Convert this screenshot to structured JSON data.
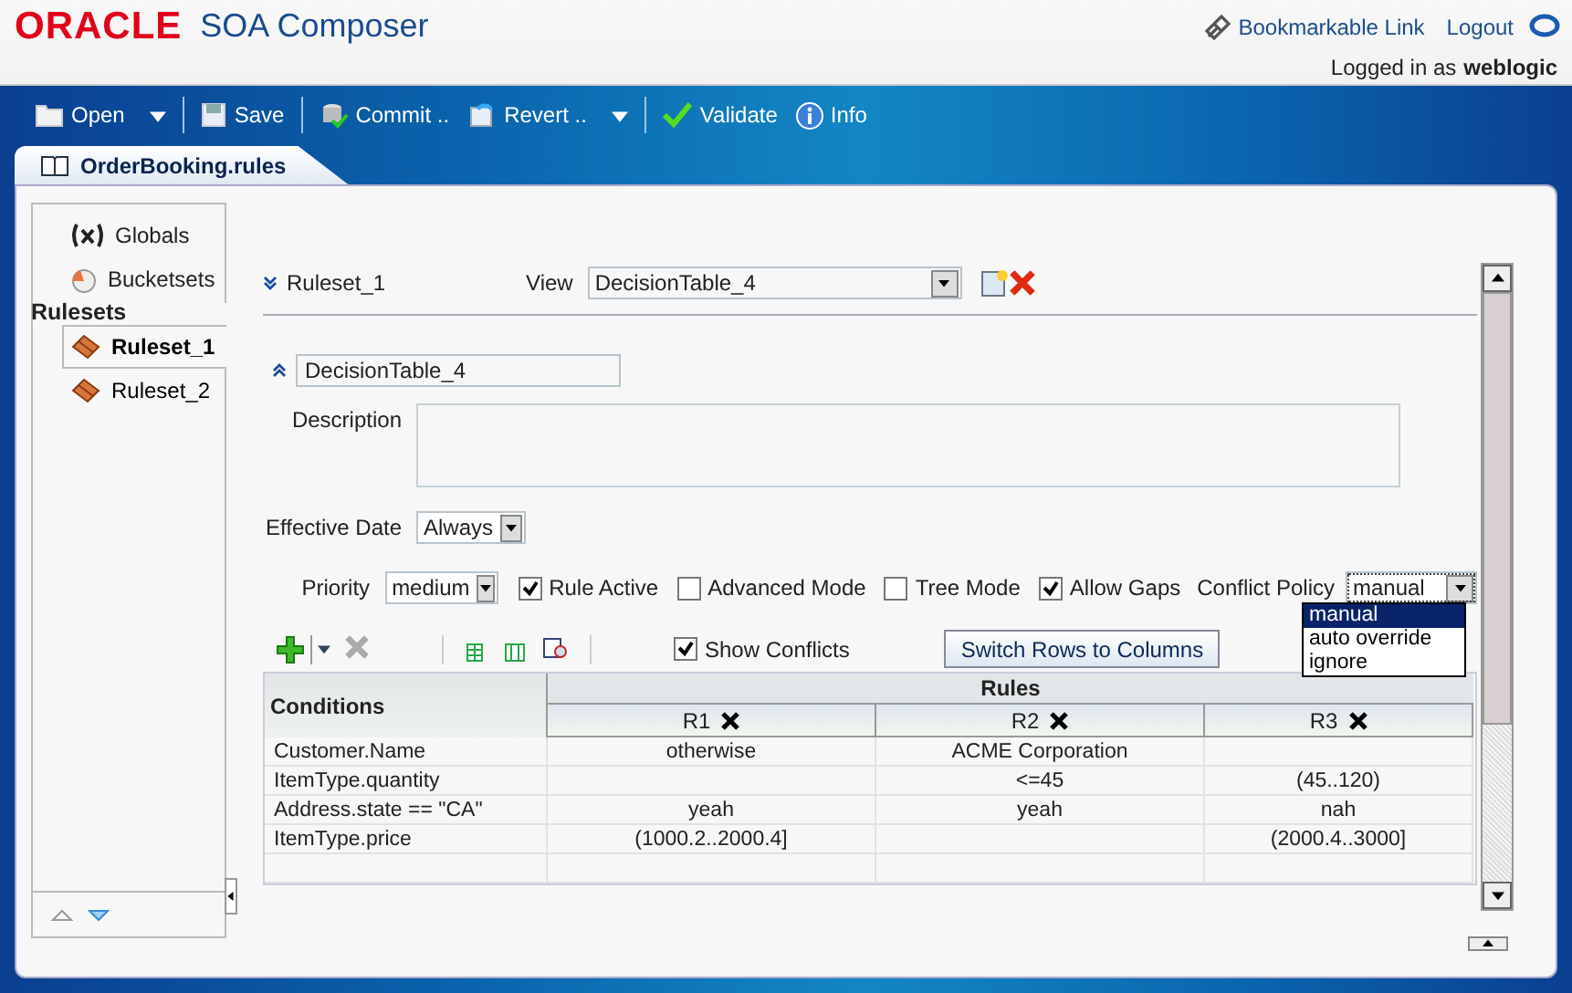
{
  "header": {
    "logo": "ORACLE",
    "product": "SOA Composer",
    "links": [
      {
        "kind": "bookmark",
        "label": "Bookmarkable Link"
      },
      {
        "kind": "logout",
        "label": "Logout"
      }
    ],
    "login_label": "Logged in as",
    "user": "weblogic"
  },
  "toolbar": [
    {
      "kind": "open",
      "label": "Open",
      "menu": true,
      "separator_after": true
    },
    {
      "kind": "save",
      "label": "Save",
      "menu": false,
      "separator_after": true
    },
    {
      "kind": "commit",
      "label": "Commit ..",
      "menu": false,
      "separator_after": false
    },
    {
      "kind": "revert",
      "label": "Revert ..",
      "menu": true,
      "separator_after": true
    },
    {
      "kind": "validate",
      "label": "Validate",
      "menu": false,
      "separator_after": false
    },
    {
      "kind": "info",
      "label": "Info",
      "menu": false,
      "separator_after": false
    }
  ],
  "document_tab": {
    "label": "OrderBooking.rules",
    "selected": true
  },
  "sidebar": {
    "items": [
      {
        "kind": "globals",
        "label": "Globals"
      },
      {
        "kind": "bucketsets",
        "label": "Bucketsets"
      }
    ],
    "section": "Rulesets",
    "rulesets": [
      {
        "label": "Ruleset_1",
        "selected": true
      },
      {
        "label": "Ruleset_2",
        "selected": false
      }
    ]
  },
  "ruleset": {
    "name": "Ruleset_1",
    "expanded": false,
    "view_label": "View",
    "view_value": "DecisionTable_4"
  },
  "decision_table": {
    "name": "DecisionTable_4",
    "expanded": true,
    "description_label": "Description",
    "effective_date_label": "Effective Date",
    "effective_date": "Always",
    "priority_label": "Priority",
    "priority": "medium",
    "options": [
      {
        "label": "Rule Active",
        "checked": true
      },
      {
        "label": "Advanced Mode",
        "checked": false
      },
      {
        "label": "Tree Mode",
        "checked": false
      },
      {
        "label": "Allow Gaps",
        "checked": true
      }
    ],
    "conflict_policy_label": "Conflict Policy",
    "conflict_policy": "manual",
    "conflict_policy_options": [
      {
        "label": "manual",
        "selected": true
      },
      {
        "label": "auto override",
        "selected": false
      },
      {
        "label": "ignore",
        "selected": false
      }
    ]
  },
  "table_toolbar": {
    "show_conflicts": {
      "label": "Show Conflicts",
      "checked": true
    },
    "switch_button": "Switch Rows to Columns"
  },
  "table": {
    "conditions_header": "Conditions",
    "rules_header": "Rules",
    "rules": [
      "R1",
      "R2",
      "R3"
    ],
    "rows": [
      {
        "condition": "Customer.Name",
        "cells": [
          "otherwise",
          "ACME Corporation",
          null
        ]
      },
      {
        "condition": "ItemType.quantity",
        "cells": [
          null,
          "<=45",
          "(45..120)"
        ]
      },
      {
        "condition": "Address.state == \"CA\"",
        "cells": [
          "yeah",
          "yeah",
          "nah"
        ]
      },
      {
        "condition": "ItemType.price",
        "cells": [
          "(1000.2..2000.4]",
          null,
          "(2000.4..3000]"
        ]
      }
    ]
  }
}
